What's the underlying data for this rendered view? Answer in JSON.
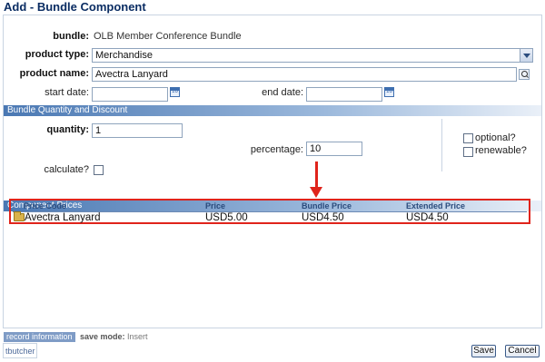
{
  "title": "Add - Bundle Component",
  "form": {
    "bundle_label": "bundle:",
    "bundle_value": "OLB Member Conference Bundle",
    "product_type_label": "product type:",
    "product_type_value": "Merchandise",
    "product_name_label": "product name:",
    "product_name_value": "Avectra Lanyard",
    "start_date_label": "start date:",
    "start_date_value": "",
    "end_date_label": "end date:",
    "end_date_value": "",
    "calendar_glyph": "16"
  },
  "quantity_section": {
    "header": "Bundle Quantity and Discount",
    "quantity_label": "quantity:",
    "quantity_value": "1",
    "percentage_label": "percentage:",
    "percentage_value": "10",
    "calculate_label": "calculate?",
    "optional_label": "optional?",
    "renewable_label": "renewable?"
  },
  "prices_section": {
    "header": "Component Prices",
    "columns": [
      "Price Code",
      "Price",
      "Bundle Price",
      "Extended Price"
    ],
    "rows": [
      {
        "price_code": "Avectra Lanyard",
        "price": "USD5.00",
        "bundle_price": "USD4.50",
        "extended_price": "USD4.50"
      }
    ]
  },
  "footer": {
    "record_tab": "record information",
    "save_mode_label": "save mode:",
    "save_mode_value": "Insert",
    "user": "tbutcher",
    "save_label": "Save",
    "cancel_label": "Cancel"
  },
  "colors": {
    "title": "#0b2d63",
    "section_bar": "#4a78b3",
    "highlight": "#e0241b"
  }
}
